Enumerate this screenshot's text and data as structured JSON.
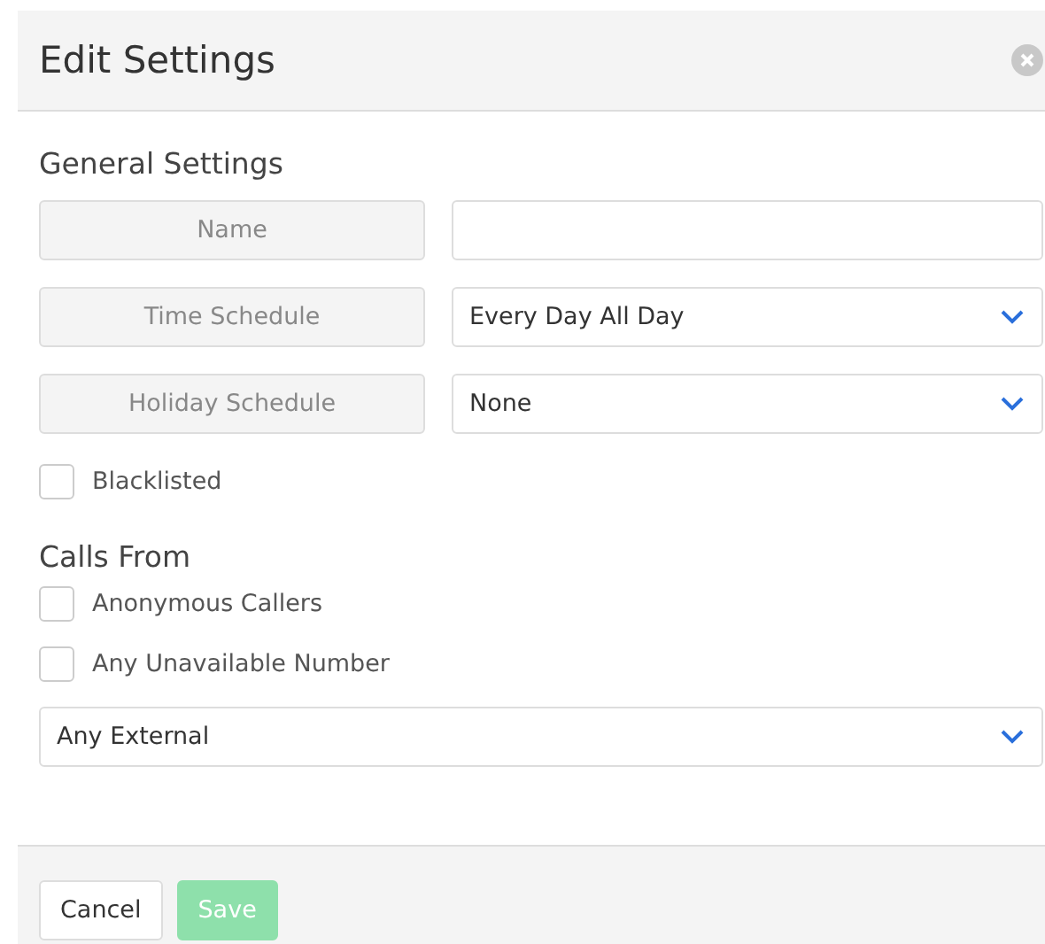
{
  "dialog": {
    "title": "Edit Settings"
  },
  "general": {
    "heading": "General Settings",
    "fields": [
      {
        "kind": "text",
        "label": "Name"
      },
      {
        "kind": "select",
        "label": "Time Schedule",
        "value": "Every Day All Day"
      },
      {
        "kind": "select",
        "label": "Holiday Schedule",
        "value": "None"
      }
    ],
    "checkboxes": [
      {
        "label": "Blacklisted",
        "checked": false
      }
    ]
  },
  "calls_from": {
    "heading": "Calls From",
    "checkboxes": [
      {
        "label": "Anonymous Callers",
        "checked": false
      },
      {
        "label": "Any Unavailable Number",
        "checked": false
      }
    ],
    "select": {
      "value": "Any External"
    }
  },
  "footer": {
    "buttons": [
      {
        "kind": "cancel",
        "label": "Cancel",
        "disabled": false
      },
      {
        "kind": "save",
        "label": "Save",
        "disabled": true
      }
    ]
  }
}
